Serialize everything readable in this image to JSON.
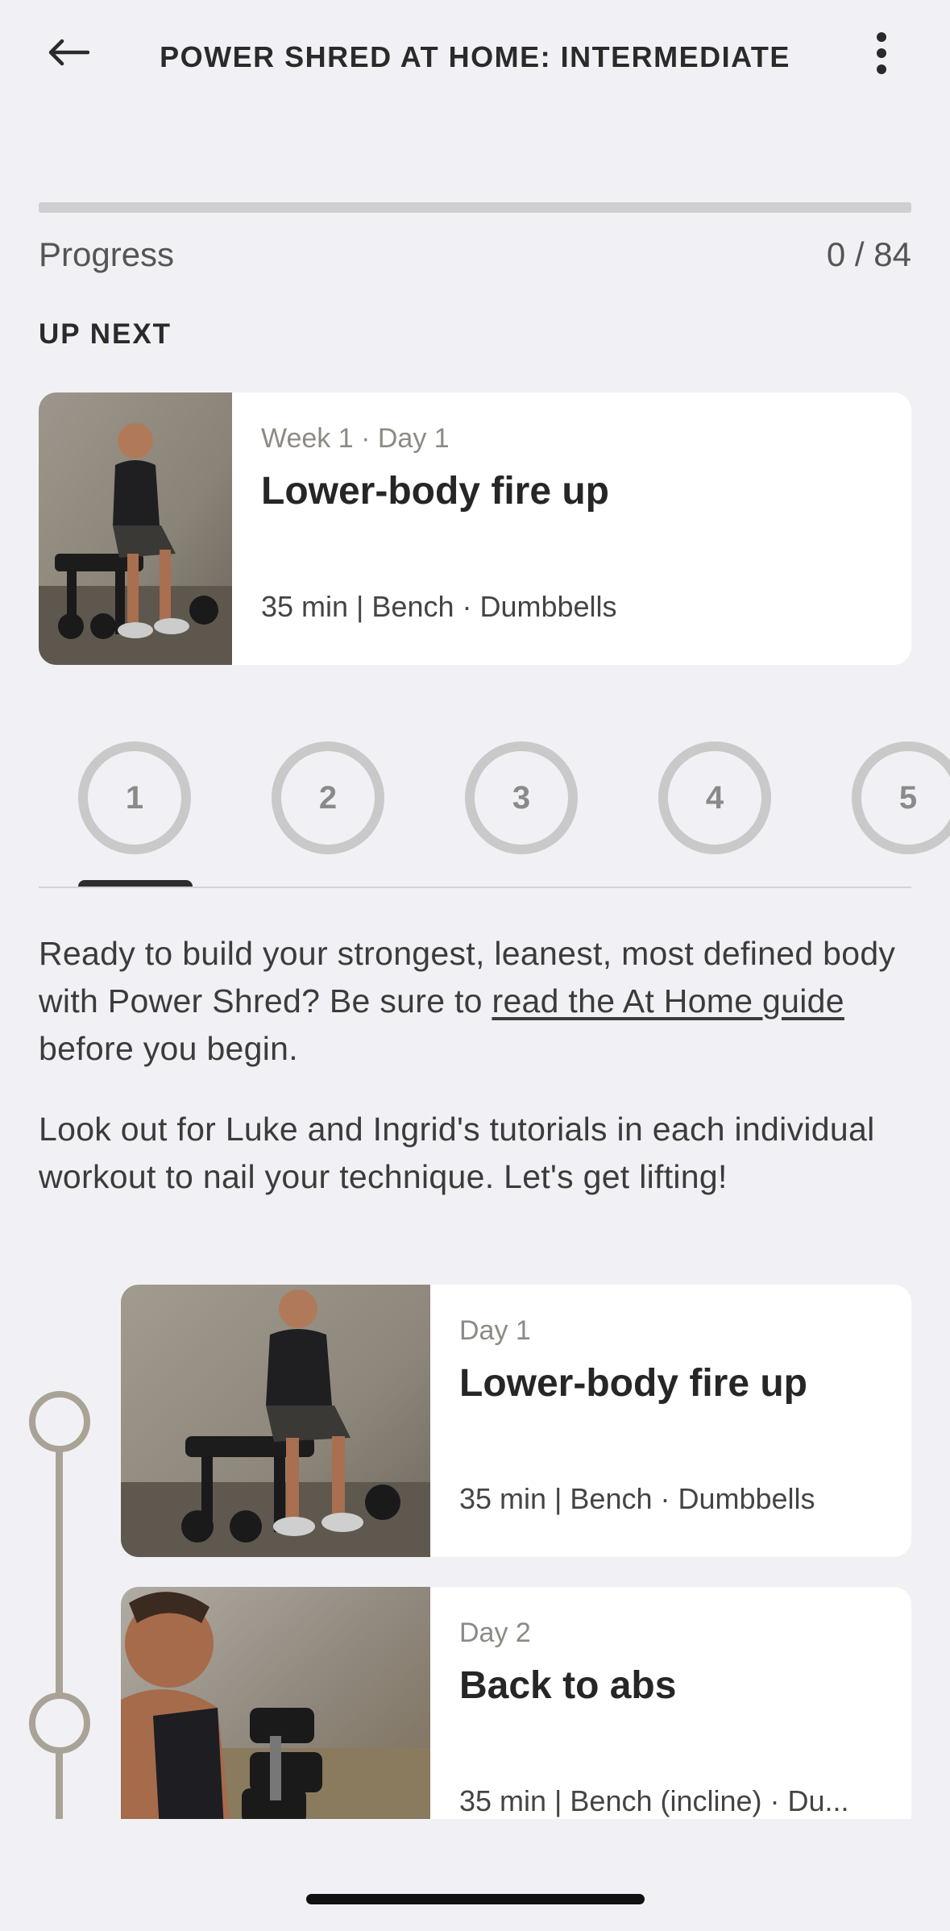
{
  "header": {
    "title": "POWER SHRED AT HOME: INTERMEDIATE",
    "back_icon": "arrow-left-icon",
    "more_icon": "more-vertical-icon"
  },
  "progress": {
    "label": "Progress",
    "count": "0 / 84",
    "completed": 0,
    "total": 84
  },
  "up_next": {
    "heading": "UP NEXT",
    "card": {
      "meta": "Week 1 · Day 1",
      "title": "Lower-body fire up",
      "detail": "35 min | Bench · Dumbbells"
    }
  },
  "weeks": {
    "items": [
      "1",
      "2",
      "3",
      "4",
      "5"
    ],
    "selected": "1"
  },
  "description": {
    "p1_before": "Ready to build your strongest, leanest, most defined body with Power Shred? Be sure to ",
    "p1_link": "read the At Home guide",
    "p1_after": " before you begin.",
    "p2": "Look out for Luke and Ingrid's tutorials in each individual workout to nail your technique. Let's get lifting!"
  },
  "days": [
    {
      "meta": "Day 1",
      "title": "Lower-body fire up",
      "detail": "35 min | Bench · Dumbbells"
    },
    {
      "meta": "Day 2",
      "title": "Back to abs",
      "detail": "35 min | Bench (incline) · Du..."
    }
  ],
  "colors": {
    "background": "#f1f1f5",
    "card": "#ffffff",
    "timeline": "#a9a397",
    "week_circle": "#c9c9ca"
  }
}
